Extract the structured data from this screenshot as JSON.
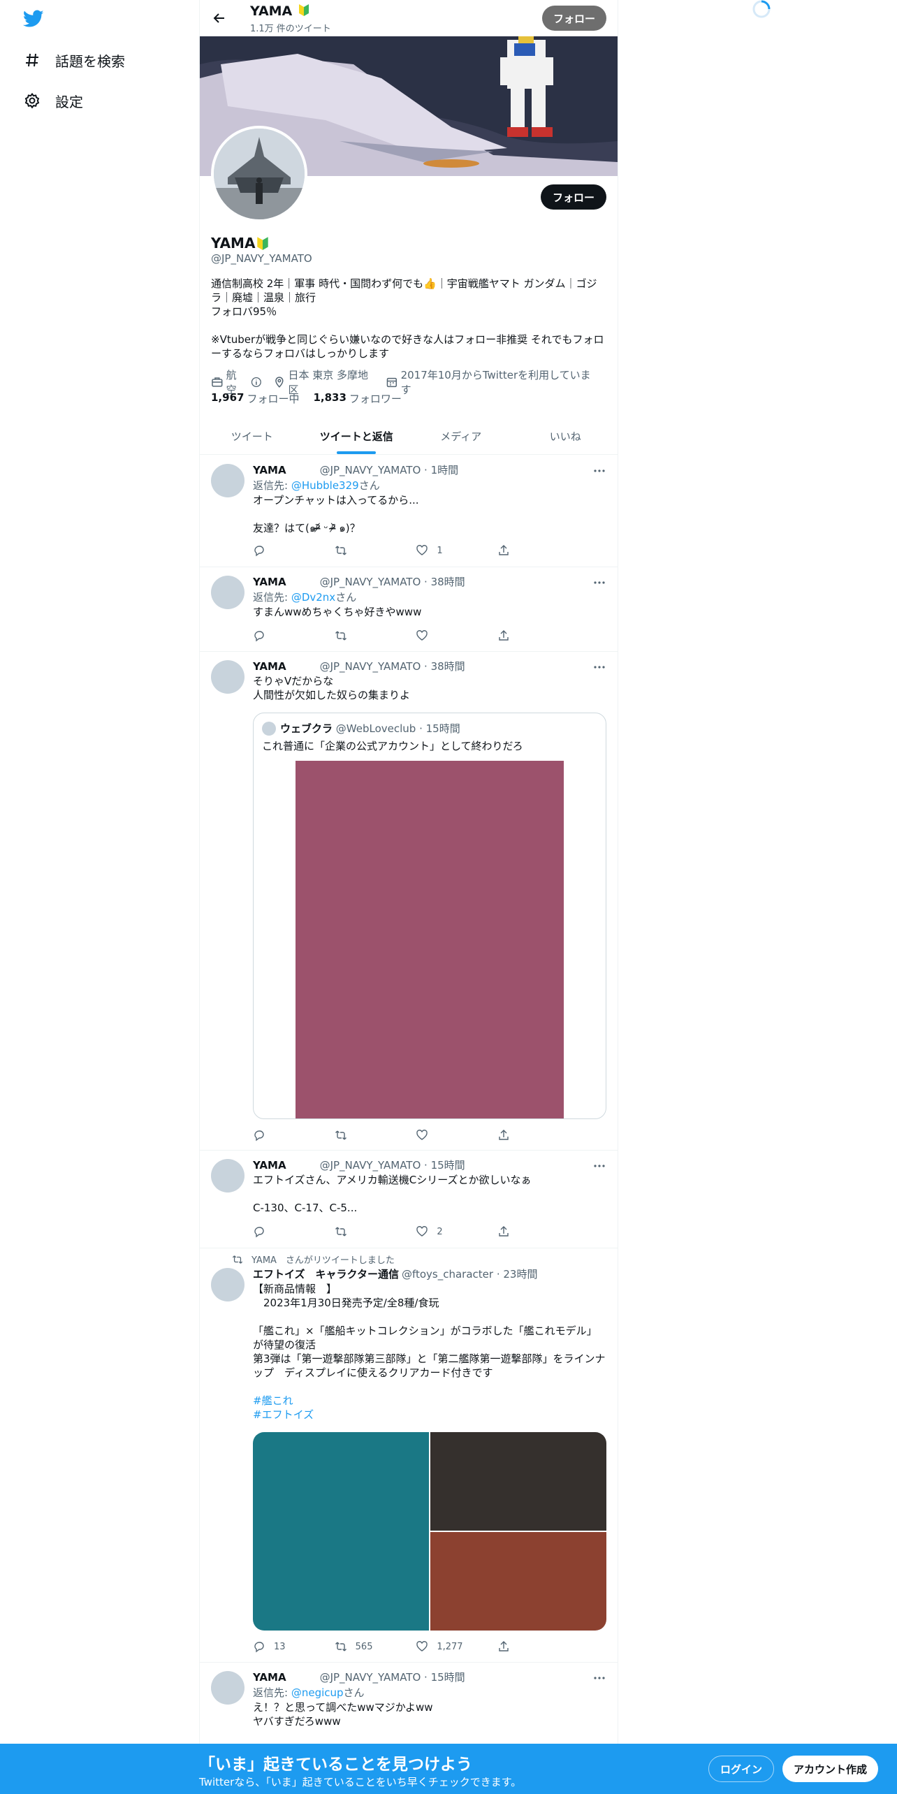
{
  "nav": {
    "explore_label": "話題を検索",
    "settings_label": "設定"
  },
  "profile": {
    "name": "YAMA",
    "tweet_count": "1.1万 件のツイート",
    "follow_label": "フォロー",
    "handle": "@JP_NAVY_YAMATO",
    "bio": "通信制高校 2年｜軍事 時代・国問わず何でも👍｜宇宙戦艦ヤマト ガンダム｜ゴジラ｜廃墟｜温泉｜旅行\nフォロバ95％\n\n※Vtuberが戦争と同じぐらい嫌いなので好きな人はフォロー非推奨 それでもフォローするならフォロバはしっかりします",
    "category": "航空",
    "location": "日本 東京 多摩地区",
    "joined": "2017年10月からTwitterを利用しています",
    "following_count": "1,967",
    "following_label": "フォロー中",
    "followers_count": "1,833",
    "followers_label": "フォロワー"
  },
  "tabs": [
    "ツイート",
    "ツイートと返信",
    "メディア",
    "いいね"
  ],
  "active_tab": 1,
  "tweets": [
    {
      "name": "YAMA",
      "handle": "@JP_NAVY_YAMATO · 1時間",
      "reply_prefix": "返信先: ",
      "reply_to": "@Hubble329",
      "reply_suffix": "さん",
      "text": "オープンチャットは入ってるから...\n\n友達？はて(๑ᵒ̴̶̷᷄ ᵕ ᵒ̴̶̷᷅ ๑)？",
      "replies": "",
      "retweets": "",
      "likes": "1"
    },
    {
      "name": "YAMA",
      "handle": "@JP_NAVY_YAMATO · 38時間",
      "reply_prefix": "返信先: ",
      "reply_to": "@Dv2nx",
      "reply_suffix": "さん",
      "text": "すまんwwめちゃくちゃ好きやwww",
      "replies": "",
      "retweets": "",
      "likes": ""
    },
    {
      "name": "YAMA",
      "handle": "@JP_NAVY_YAMATO · 38時間",
      "text": "そりゃVだからな\n人間性が欠如した奴らの集まりよ",
      "quote": {
        "name": "ウェブクラ",
        "handle": "@WebLoveclub · 15時間",
        "text": "これ普通に「企業の公式アカウント」として終わりだろ"
      },
      "replies": "",
      "retweets": "",
      "likes": ""
    },
    {
      "name": "YAMA",
      "handle": "@JP_NAVY_YAMATO · 15時間",
      "text": "エフトイズさん、アメリカ輸送機Cシリーズとか欲しいなぁ\n\nC-130、C-17、C-5...",
      "replies": "",
      "retweets": "",
      "likes": "2"
    },
    {
      "retweeted_by": "YAMA　さんがリツイートしました",
      "name": "エフトイズ　キャラクター通信",
      "handle": "@ftoys_character · 23時間",
      "text": "【新商品情報　】\n　2023年1月30日発売予定/全8種/食玩\n\n「艦これ」×「艦船キットコレクション」がコラボした「艦これモデル」が待望の復活\n第3弾は「第一遊撃部隊第三部隊」と「第二艦隊第一遊撃部隊」をラインナップ　ディスプレイに使えるクリアカード付きです",
      "hashtags": [
        "#艦これ",
        "#エフトイズ"
      ],
      "replies": "13",
      "retweets": "565",
      "likes": "1,277"
    },
    {
      "name": "YAMA",
      "handle": "@JP_NAVY_YAMATO · 15時間",
      "reply_prefix": "返信先: ",
      "reply_to": "@negicup",
      "reply_suffix": "さん",
      "text": "え！？と思って調べたwwマジかよww\nヤバすぎだろwww"
    }
  ],
  "bottom_bar": {
    "title": "「いま」起きていることを見つけよう",
    "subtitle": "Twitterなら、「いま」起きていることをいち早くチェックできます。",
    "login_label": "ログイン",
    "signup_label": "アカウント作成"
  },
  "colors": {
    "accent": "#1d9bf0",
    "quote_media": "#9c526c",
    "media_teal": "#1a7885",
    "media_dark": "#35302d",
    "media_rust": "#8c4130"
  }
}
